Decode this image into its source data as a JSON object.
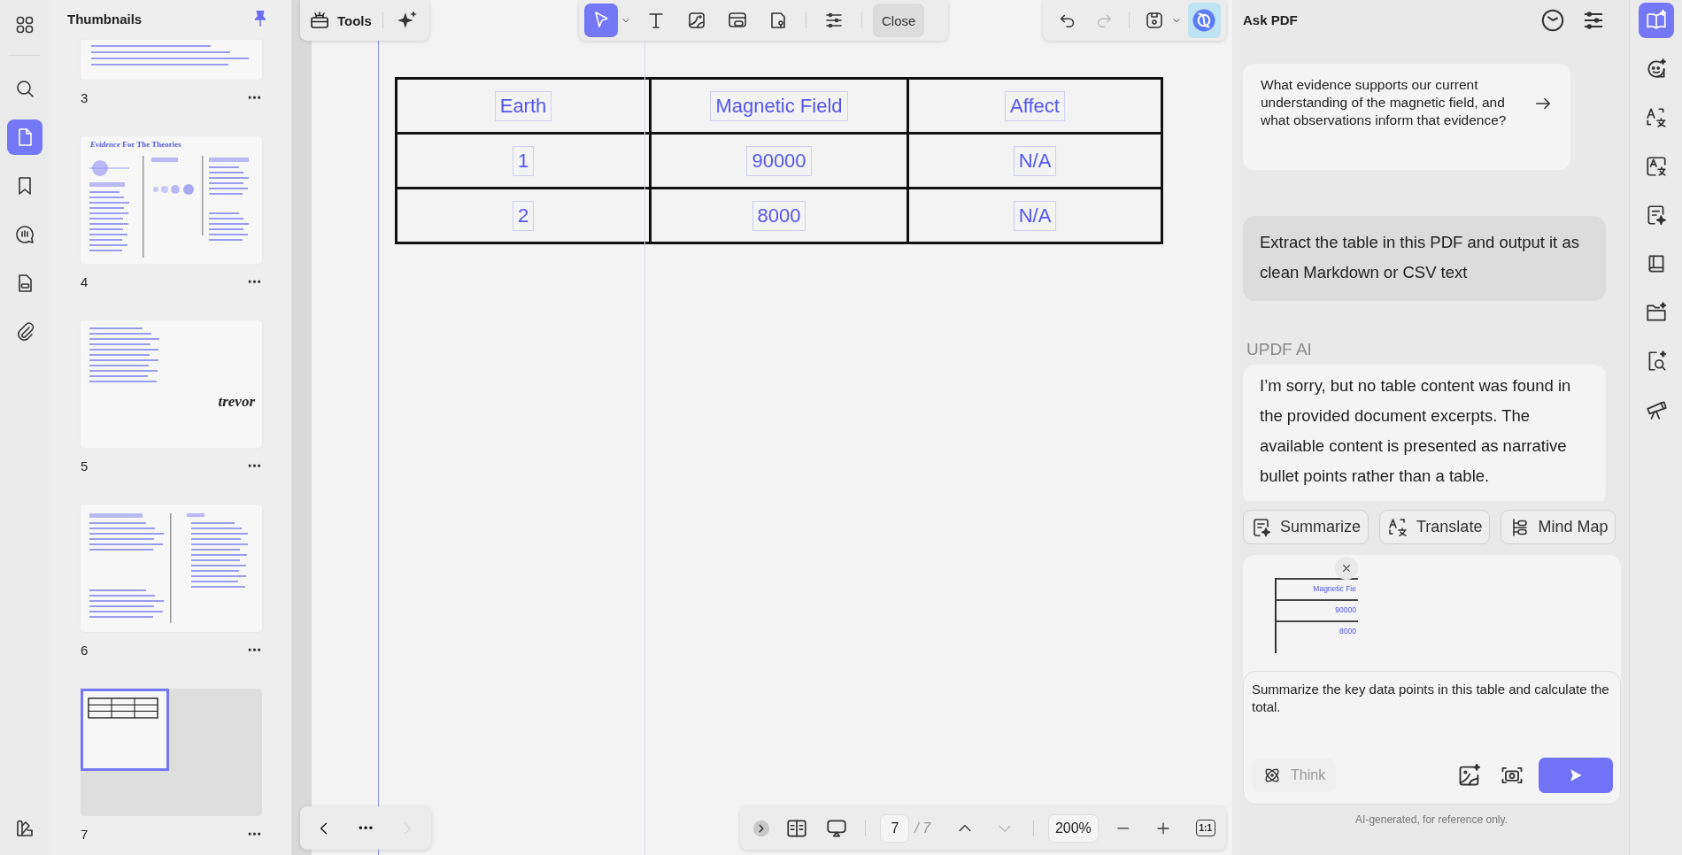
{
  "left_rail": {
    "top": [
      {
        "kind": "apps",
        "selected": false
      }
    ],
    "tools": [
      {
        "kind": "search",
        "selected": false
      },
      {
        "kind": "pages",
        "selected": true
      },
      {
        "kind": "bookmark",
        "selected": false
      },
      {
        "kind": "comment",
        "selected": false
      },
      {
        "kind": "form",
        "selected": false
      },
      {
        "kind": "attachment",
        "selected": false
      }
    ],
    "bottom": [
      {
        "kind": "theme",
        "selected": false
      }
    ]
  },
  "thumbnails": {
    "title": "Thumbnails",
    "pinned": true,
    "pages": [
      {
        "number": "3",
        "kind": "text",
        "selected": false
      },
      {
        "number": "4",
        "kind": "diagram",
        "title": "*Evidence* For The Theories",
        "selected": false
      },
      {
        "number": "5",
        "kind": "signature",
        "signature": "trevor",
        "selected": false
      },
      {
        "number": "6",
        "kind": "two-column",
        "selected": false
      },
      {
        "number": "7",
        "kind": "table",
        "selected": true
      }
    ]
  },
  "toolbar": {
    "tools_label": "Tools",
    "tools": [
      {
        "kind": "select",
        "selected": true
      },
      {
        "kind": "text",
        "selected": false
      },
      {
        "kind": "image",
        "selected": false
      },
      {
        "kind": "link",
        "selected": false
      },
      {
        "kind": "stamp",
        "selected": false
      },
      {
        "kind": "properties",
        "selected": false
      }
    ],
    "close_label": "Close",
    "history": [
      {
        "kind": "undo",
        "disabled": false
      },
      {
        "kind": "redo",
        "disabled": true
      }
    ]
  },
  "document": {
    "table": {
      "rows": [
        [
          "Earth",
          "Magnetic Field",
          "Affect"
        ],
        [
          "1",
          "90000",
          "N/A"
        ],
        [
          "2",
          "8000",
          "N/A"
        ]
      ]
    }
  },
  "page_nav": [
    {
      "kind": "previous",
      "disabled": false
    },
    {
      "kind": "more",
      "disabled": false
    },
    {
      "kind": "next",
      "disabled": true
    }
  ],
  "zoom_bar": {
    "current_page": "7",
    "page_total": "/ 7",
    "page_up_disabled": false,
    "page_down_disabled": true,
    "zoom": "200%",
    "actual_size_label": "1:1"
  },
  "ai_panel": {
    "title": "Ask PDF",
    "messages": [
      {
        "kind": "suggestion",
        "text": "What evidence supports our current understanding of the magnetic field, and what observations inform that evidence?"
      },
      {
        "kind": "user",
        "text": "Extract the table in this PDF and output it as clean Markdown or CSV text"
      },
      {
        "kind": "assistant",
        "sender": "UPDF AI",
        "text": "I’m sorry, but no table content was found in the provided document excerpts. The available content is presented as narrative bullet points rather than a table."
      }
    ],
    "quick_actions": [
      {
        "kind": "summarize",
        "label": "Summarize"
      },
      {
        "kind": "translate",
        "label": "Translate"
      },
      {
        "kind": "mind-map",
        "label": "Mind Map"
      }
    ],
    "attachment": {
      "cells": [
        "Magnetic Fie",
        "90000",
        "8000"
      ]
    },
    "input": {
      "value": "Summarize the key data points in this table and calculate the total.",
      "think_label": "Think",
      "think_on": false
    },
    "disclaimer": "AI-generated, for reference only."
  },
  "right_rail": [
    {
      "kind": "ask-pdf",
      "selected": true
    },
    {
      "kind": "chat",
      "selected": false
    },
    {
      "kind": "translate",
      "selected": false
    },
    {
      "kind": "translate-doc",
      "selected": false
    },
    {
      "kind": "summarize",
      "selected": false
    },
    {
      "kind": "book",
      "selected": false
    },
    {
      "kind": "folder-sparkle",
      "selected": false
    },
    {
      "kind": "search-sparkle",
      "selected": false
    },
    {
      "kind": "telescope",
      "selected": false
    }
  ]
}
